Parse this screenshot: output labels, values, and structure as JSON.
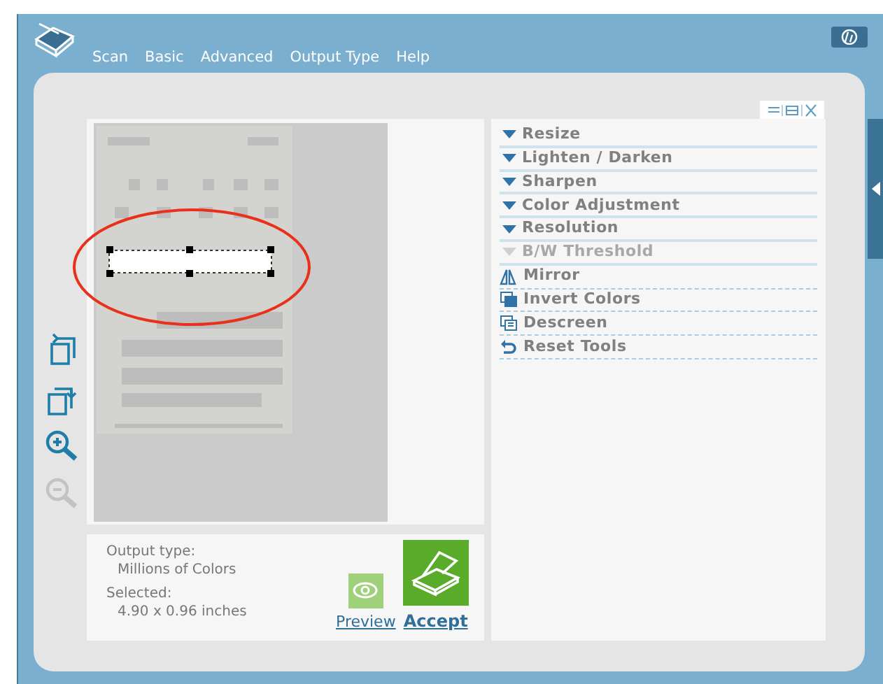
{
  "menu": [
    {
      "label": "Scan"
    },
    {
      "label": "Basic"
    },
    {
      "label": "Advanced"
    },
    {
      "label": "Output Type"
    },
    {
      "label": "Help"
    }
  ],
  "side_tools": [
    {
      "kind": "rotate-left",
      "disabled": false
    },
    {
      "kind": "rotate-right",
      "disabled": false
    },
    {
      "kind": "zoom-in",
      "disabled": false
    },
    {
      "kind": "zoom-out",
      "disabled": true
    }
  ],
  "info": {
    "output_type_label": "Output type:",
    "output_type": "Millions of Colors",
    "selected_label": "Selected:",
    "selected": "4.90 x 0.96 inches"
  },
  "actions": [
    {
      "kind": "preview",
      "label": "Preview"
    },
    {
      "kind": "accept",
      "label": "Accept"
    }
  ],
  "tools": [
    {
      "kind": "dropdown",
      "label": "Resize",
      "disabled": false
    },
    {
      "kind": "dropdown",
      "label": "Lighten / Darken",
      "disabled": false
    },
    {
      "kind": "dropdown",
      "label": "Sharpen",
      "disabled": false
    },
    {
      "kind": "dropdown",
      "label": "Color Adjustment",
      "disabled": false
    },
    {
      "kind": "dropdown",
      "label": "Resolution",
      "disabled": false
    },
    {
      "kind": "dropdown",
      "label": "B/W Threshold",
      "disabled": true
    },
    {
      "kind": "mirror",
      "label": "Mirror",
      "disabled": false
    },
    {
      "kind": "invert",
      "label": "Invert Colors",
      "disabled": false
    },
    {
      "kind": "descreen",
      "label": "Descreen",
      "disabled": false
    },
    {
      "kind": "reset",
      "label": "Reset Tools",
      "disabled": false
    }
  ]
}
